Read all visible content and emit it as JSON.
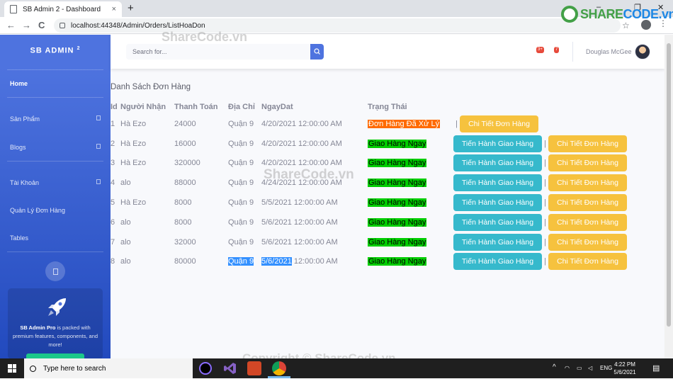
{
  "browser": {
    "tab_title": "SB Admin 2 - Dashboard",
    "tab_close": "×",
    "new_tab": "+",
    "url": "localhost:44348/Admin/Orders/ListHoaDon",
    "back": "←",
    "forward": "→",
    "reload": "C",
    "star": "☆",
    "menu": "⋮",
    "minimize": "–",
    "maximize": "❐",
    "close": "✕"
  },
  "watermark_logo": {
    "share": "SHARE",
    "code": "CODE.vn"
  },
  "watermarks": [
    "ShareCode.vn",
    "ShareCode.vn",
    "Copyright © ShareCode.vn"
  ],
  "sidebar": {
    "brand": "SB ADMIN",
    "brand_sup": "2",
    "items": [
      {
        "label": "Home"
      },
      {
        "label": "Sản Phẩm"
      },
      {
        "label": "Blogs"
      },
      {
        "label": "Tài Khoản"
      },
      {
        "label": "Quản Lý Đơn Hàng"
      },
      {
        "label": "Tables"
      }
    ],
    "promo": {
      "bold": "SB Admin Pro",
      "text": " is packed with premium features, components, and more!"
    }
  },
  "topbar": {
    "search_placeholder": "Search for...",
    "alerts_badge": "3+",
    "messages_badge": "7",
    "user_name": "Douglas McGee"
  },
  "page": {
    "heading": "Danh Sách Đơn Hàng"
  },
  "orders": {
    "headers": [
      "Id",
      "Người Nhận",
      "Thanh Toán",
      "Địa Chỉ",
      "NgayDat",
      "Trạng Thái"
    ],
    "separator": "|",
    "btn_deliver": "Tiến Hành Giao Hàng",
    "btn_detail": "Chi Tiết Đơn Hàng",
    "rows": [
      {
        "id": "1",
        "name": "Hà Ezo",
        "pay": "24000",
        "addr": "Quận 9",
        "date": "4/20/2021",
        "time": "12:00:00 AM",
        "status": "Đơn Hàng Đã Xử Lý"
      },
      {
        "id": "2",
        "name": "Hà Ezo",
        "pay": "16000",
        "addr": "Quận 9",
        "date": "4/20/2021",
        "time": "12:00:00 AM",
        "status": "Giao Hàng Ngay"
      },
      {
        "id": "3",
        "name": "Hà Ezo",
        "pay": "320000",
        "addr": "Quận 9",
        "date": "4/20/2021",
        "time": "12:00:00 AM",
        "status": "Giao Hàng Ngay"
      },
      {
        "id": "4",
        "name": "alo",
        "pay": "88000",
        "addr": "Quận 9",
        "date": "4/24/2021",
        "time": "12:00:00 AM",
        "status": "Giao Hàng Ngay"
      },
      {
        "id": "5",
        "name": "Hà Ezo",
        "pay": "8000",
        "addr": "Quận 9",
        "date": "5/5/2021",
        "time": "12:00:00 AM",
        "status": "Giao Hàng Ngay"
      },
      {
        "id": "6",
        "name": "alo",
        "pay": "8000",
        "addr": "Quận 9",
        "date": "5/6/2021",
        "time": "12:00:00 AM",
        "status": "Giao Hàng Ngay"
      },
      {
        "id": "7",
        "name": "alo",
        "pay": "32000",
        "addr": "Quận 9",
        "date": "5/6/2021",
        "time": "12:00:00 AM",
        "status": "Giao Hàng Ngay"
      },
      {
        "id": "8",
        "name": "alo",
        "pay": "80000",
        "addr": "Quận 9",
        "date": "5/6/2021",
        "time": "12:00:00 AM",
        "status": "Giao Hàng Ngay"
      }
    ]
  },
  "taskbar": {
    "search_placeholder": "Type here to search",
    "lang": "ENG",
    "time": "4:22 PM",
    "date": "5/6/2021",
    "tray_chevron": "^"
  },
  "colors": {
    "sidebar": "#4e73df",
    "status_processed": "#ff6a00",
    "status_ship": "#00cc00",
    "btn_info": "#36b9cc",
    "btn_warning": "#f6c23e",
    "selection": "#3390ff"
  }
}
